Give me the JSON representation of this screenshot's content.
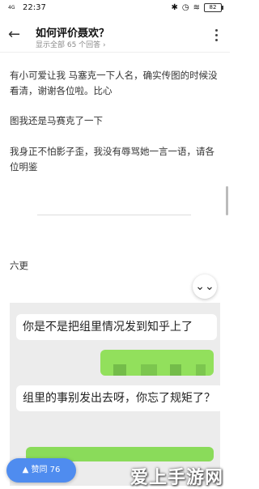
{
  "status": {
    "time": "22:37",
    "battery": "82",
    "network": "4G"
  },
  "header": {
    "back_icon": "arrow-left-icon",
    "title": "如何评价聂欢？",
    "subtitle": "显示全部 65 个回答 ›",
    "more_icon": "more-vertical-icon"
  },
  "answer": {
    "paragraphs": [
      "有小可爱让我 马塞克一下人名，确实传图的时候没看清，谢谢各位啦。比心",
      "图我还是马赛克了一下",
      "我身正不怕影子歪，我没有辱骂她一言一语，请各位明鉴"
    ],
    "section_label": "六更",
    "collapse_icon": "double-chevron-down-icon"
  },
  "chat": {
    "messages": [
      {
        "side": "left",
        "text": "你是不是把组里情况发到知乎上了"
      },
      {
        "side": "right",
        "text": ""
      },
      {
        "side": "left",
        "text": "组里的事别发出去呀，你忘了规矩了？"
      }
    ]
  },
  "vote": {
    "label": "▲ 赞同 76"
  },
  "watermark": {
    "text": "爱上手游网"
  }
}
